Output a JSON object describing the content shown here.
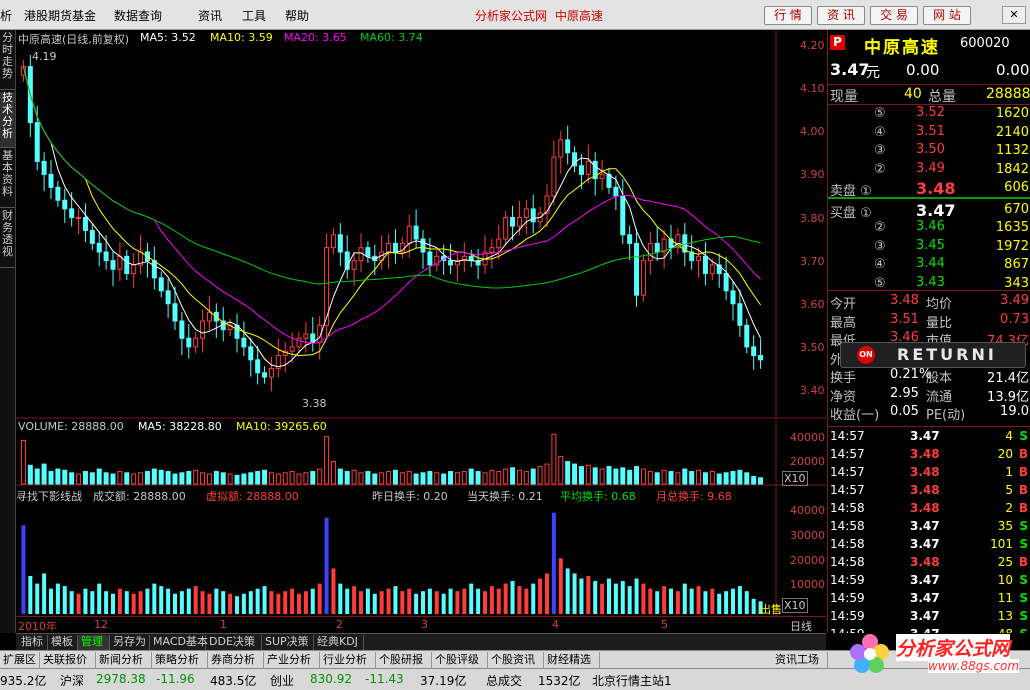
{
  "menu": {
    "items": [
      "析",
      "港股期货基金",
      "数据查询",
      "资讯",
      "工具",
      "帮助"
    ],
    "brand": "分析家公式网",
    "stock": "中原高速",
    "buttons": [
      "行 情",
      "资 讯",
      "交 易",
      "网 站"
    ]
  },
  "side_tabs": [
    "分时走势",
    "技术分析",
    "基本资料",
    "财务透视"
  ],
  "kline": {
    "title": "中原高速(日线,前复权)",
    "ma5": "MA5: 3.52",
    "ma10": "MA10: 3.59",
    "ma20": "MA20: 3.65",
    "ma60": "MA60: 3.74",
    "high_label": "4.19",
    "low_label": "3.38",
    "price_ticks": [
      "4.20",
      "4.10",
      "4.00",
      "3.90",
      "3.80",
      "3.70",
      "3.60",
      "3.50",
      "3.40"
    ]
  },
  "volume": {
    "title": "VOLUME: 28888.00",
    "ma5": "MA5: 38228.80",
    "ma10": "MA10: 39265.60",
    "ticks": [
      "40000",
      "20000"
    ],
    "unit": "X10"
  },
  "indicator": {
    "title": "寻找下影线战",
    "turnover": "成交额: 28888.00",
    "virtual": "虚拟额: 28888.00",
    "prev": "昨日换手: 0.20",
    "today": "当天换手: 0.21",
    "avg": "平均换手: 0.68",
    "month": "月总换手: 9.68",
    "ticks": [
      "40000",
      "30000",
      "20000",
      "10000"
    ],
    "unit": "X10",
    "tail": "出售"
  },
  "dates": [
    "2010年",
    "12",
    "1",
    "2",
    "3",
    "4",
    "5"
  ],
  "period": "日线",
  "tabbar1": [
    "指标",
    "模板",
    "管理",
    "另存为",
    "MACD基本",
    "DDE决策",
    "SUP决策",
    "经典KDJ"
  ],
  "tabbar2": [
    "扩展区",
    "关联报价",
    "新闻分析",
    "策略分析",
    "券商分析",
    "产业分析",
    "行业分析",
    "个股研报",
    "个股评级",
    "个股资讯",
    "财经精选"
  ],
  "tabbar2_right": "资讯工场",
  "status": {
    "a": "935.2亿",
    "b": "沪深",
    "c": "2978.38",
    "d": "-11.96",
    "e": "483.5亿",
    "f": "创业",
    "g": "830.92",
    "h": "-11.43",
    "i": "37.19亿",
    "j": "总成交",
    "k": "1532亿",
    "l": "北京行情主站1"
  },
  "quote": {
    "badge": "P",
    "name": "中原高速",
    "code": "600020",
    "price": "3.47",
    "unit": "元",
    "chg": "0.00",
    "chg_pct": "0.00",
    "now_vol_label": "现量",
    "now_vol": "40",
    "total_vol_label": "总量",
    "total_vol": "28888",
    "sell": [
      {
        "level": "⑤",
        "price": "3.52",
        "vol": "1620"
      },
      {
        "level": "④",
        "price": "3.51",
        "vol": "2140"
      },
      {
        "level": "③",
        "price": "3.50",
        "vol": "1132"
      },
      {
        "level": "②",
        "price": "3.49",
        "vol": "1842"
      },
      {
        "level": "卖盘 ①",
        "price": "3.48",
        "vol": "606"
      }
    ],
    "buy": [
      {
        "level": "买盘 ①",
        "price": "3.47",
        "vol": "670"
      },
      {
        "level": "②",
        "price": "3.46",
        "vol": "1635"
      },
      {
        "level": "③",
        "price": "3.45",
        "vol": "1972"
      },
      {
        "level": "④",
        "price": "3.44",
        "vol": "867"
      },
      {
        "level": "⑤",
        "price": "3.43",
        "vol": "343"
      }
    ],
    "stats": [
      {
        "l1": "今开",
        "v1": "3.48",
        "l2": "均价",
        "v2": "3.49"
      },
      {
        "l1": "最高",
        "v1": "3.51",
        "l2": "量比",
        "v2": "0.73"
      },
      {
        "l1": "最低",
        "v1": "3.46",
        "l2": "市值",
        "v2": "74.3亿"
      },
      {
        "l1": "外",
        "v1": "",
        "l2": "",
        "v2": ""
      },
      {
        "l1": "换手",
        "v1": "0.21%",
        "l2": "股本",
        "v2": "21.4亿"
      },
      {
        "l1": "净资",
        "v1": "2.95",
        "l2": "流通",
        "v2": "13.9亿"
      },
      {
        "l1": "收益(一)",
        "v1": "0.05",
        "l2": "PE(动)",
        "v2": "19.0"
      }
    ],
    "ticks": [
      {
        "t": "14:57",
        "p": "3.47",
        "v": "4",
        "s": "S"
      },
      {
        "t": "14:57",
        "p": "3.48",
        "v": "20",
        "s": "B"
      },
      {
        "t": "14:57",
        "p": "3.48",
        "v": "1",
        "s": "B"
      },
      {
        "t": "14:57",
        "p": "3.48",
        "v": "5",
        "s": "B"
      },
      {
        "t": "14:58",
        "p": "3.48",
        "v": "2",
        "s": "B"
      },
      {
        "t": "14:58",
        "p": "3.47",
        "v": "35",
        "s": "S"
      },
      {
        "t": "14:58",
        "p": "3.47",
        "v": "101",
        "s": "S"
      },
      {
        "t": "14:58",
        "p": "3.48",
        "v": "25",
        "s": "B"
      },
      {
        "t": "14:59",
        "p": "3.47",
        "v": "10",
        "s": "S"
      },
      {
        "t": "14:59",
        "p": "3.47",
        "v": "11",
        "s": "S"
      },
      {
        "t": "14:59",
        "p": "3.47",
        "v": "13",
        "s": "S"
      },
      {
        "t": "14:59",
        "p": "3.47",
        "v": "48",
        "s": "S"
      }
    ]
  },
  "popup": {
    "badge": "ON",
    "text": "RETURNI"
  },
  "watermark": {
    "title": "分析家公式网",
    "url": "www.88gs.com"
  },
  "colors": {
    "up": "#ff3c3c",
    "down": "#54ffff",
    "ma5": "#ffffff",
    "ma10": "#ffff00",
    "ma20": "#ff00ff",
    "ma60": "#00cc00",
    "grid": "#7a1a1a"
  },
  "chart_data": {
    "type": "candlestick",
    "title": "中原高速(日线,前复权)",
    "ylim": [
      3.38,
      4.22
    ],
    "period": "日线",
    "notes": "approximate daily prices read off the chart",
    "close": [
      4.15,
      4.02,
      3.93,
      3.9,
      3.87,
      3.84,
      3.82,
      3.8,
      3.8,
      3.77,
      3.74,
      3.72,
      3.7,
      3.68,
      3.71,
      3.67,
      3.69,
      3.72,
      3.7,
      3.66,
      3.63,
      3.6,
      3.56,
      3.52,
      3.5,
      3.52,
      3.56,
      3.58,
      3.56,
      3.54,
      3.55,
      3.52,
      3.5,
      3.47,
      3.44,
      3.43,
      3.45,
      3.48,
      3.49,
      3.5,
      3.52,
      3.53,
      3.51,
      3.55,
      3.73,
      3.76,
      3.72,
      3.68,
      3.7,
      3.73,
      3.71,
      3.7,
      3.72,
      3.74,
      3.72,
      3.74,
      3.78,
      3.75,
      3.72,
      3.69,
      3.71,
      3.7,
      3.69,
      3.7,
      3.71,
      3.7,
      3.69,
      3.72,
      3.73,
      3.75,
      3.8,
      3.78,
      3.8,
      3.82,
      3.79,
      3.81,
      3.85,
      3.94,
      3.98,
      3.95,
      3.92,
      3.9,
      3.93,
      3.89,
      3.9,
      3.87,
      3.85,
      3.76,
      3.74,
      3.62,
      3.7,
      3.74,
      3.72,
      3.75,
      3.73,
      3.76,
      3.72,
      3.7,
      3.71,
      3.67,
      3.69,
      3.67,
      3.63,
      3.6,
      3.55,
      3.5,
      3.48,
      3.47
    ],
    "volume": [
      35000,
      15000,
      12000,
      16000,
      10000,
      12000,
      11000,
      9000,
      8000,
      10000,
      9000,
      12000,
      9000,
      8000,
      10000,
      9000,
      8000,
      9000,
      10000,
      12000,
      11000,
      10000,
      8000,
      9000,
      10000,
      11000,
      9000,
      8000,
      10000,
      9000,
      8000,
      7000,
      8000,
      9000,
      10000,
      11000,
      9000,
      8000,
      9000,
      10000,
      8000,
      9000,
      10000,
      12000,
      38000,
      18000,
      12000,
      10000,
      11000,
      9000,
      10000,
      8000,
      9000,
      10000,
      11000,
      9000,
      10000,
      8000,
      9000,
      10000,
      9000,
      8000,
      10000,
      9000,
      10000,
      12000,
      10000,
      9000,
      11000,
      10000,
      12000,
      13000,
      11000,
      10000,
      12000,
      14000,
      16000,
      40000,
      22000,
      18000,
      16000,
      14000,
      15000,
      13000,
      12000,
      14000,
      12000,
      13000,
      11000,
      14000,
      12000,
      10000,
      9000,
      11000,
      10000,
      9000,
      12000,
      10000,
      11000,
      9000,
      10000,
      8000,
      9000,
      10000,
      11000,
      9000,
      6000,
      5000
    ]
  }
}
